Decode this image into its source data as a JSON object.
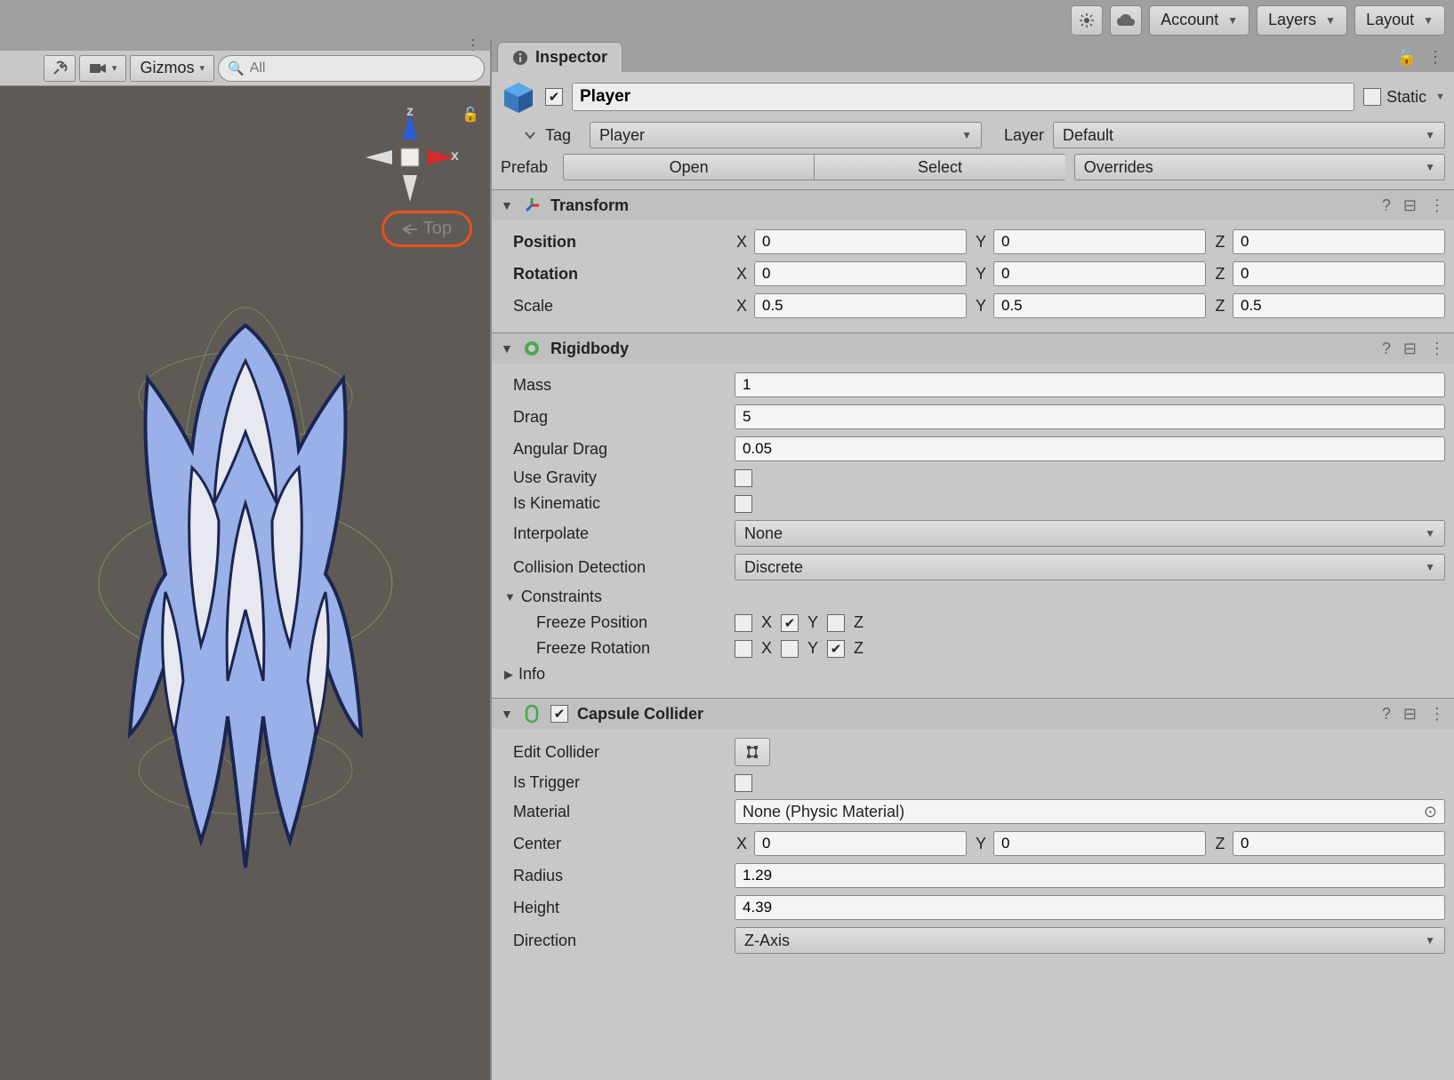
{
  "toolbar": {
    "account": "Account",
    "layers": "Layers",
    "layout": "Layout"
  },
  "scene": {
    "gizmos_label": "Gizmos",
    "search_placeholder": "All",
    "axis_z": "z",
    "axis_x": "x",
    "view_label": "Top"
  },
  "inspector": {
    "tab_title": "Inspector",
    "object_name": "Player",
    "static_label": "Static",
    "tag_label": "Tag",
    "tag_value": "Player",
    "layer_label": "Layer",
    "layer_value": "Default",
    "prefab_label": "Prefab",
    "prefab_open": "Open",
    "prefab_select": "Select",
    "prefab_overrides": "Overrides"
  },
  "transform": {
    "title": "Transform",
    "position_label": "Position",
    "rotation_label": "Rotation",
    "scale_label": "Scale",
    "pos": {
      "x": "0",
      "y": "0",
      "z": "0"
    },
    "rot": {
      "x": "0",
      "y": "0",
      "z": "0"
    },
    "scale": {
      "x": "0.5",
      "y": "0.5",
      "z": "0.5"
    }
  },
  "rigidbody": {
    "title": "Rigidbody",
    "mass_label": "Mass",
    "mass": "1",
    "drag_label": "Drag",
    "drag": "5",
    "angdrag_label": "Angular Drag",
    "angdrag": "0.05",
    "gravity_label": "Use Gravity",
    "kinematic_label": "Is Kinematic",
    "interpolate_label": "Interpolate",
    "interpolate": "None",
    "collision_label": "Collision Detection",
    "collision": "Discrete",
    "constraints_label": "Constraints",
    "freeze_pos_label": "Freeze Position",
    "freeze_rot_label": "Freeze Rotation",
    "info_label": "Info",
    "x": "X",
    "y": "Y",
    "z": "Z"
  },
  "capsule": {
    "title": "Capsule Collider",
    "edit_label": "Edit Collider",
    "trigger_label": "Is Trigger",
    "material_label": "Material",
    "material": "None (Physic Material)",
    "center_label": "Center",
    "center": {
      "x": "0",
      "y": "0",
      "z": "0"
    },
    "radius_label": "Radius",
    "radius": "1.29",
    "height_label": "Height",
    "height": "4.39",
    "direction_label": "Direction",
    "direction": "Z-Axis"
  }
}
